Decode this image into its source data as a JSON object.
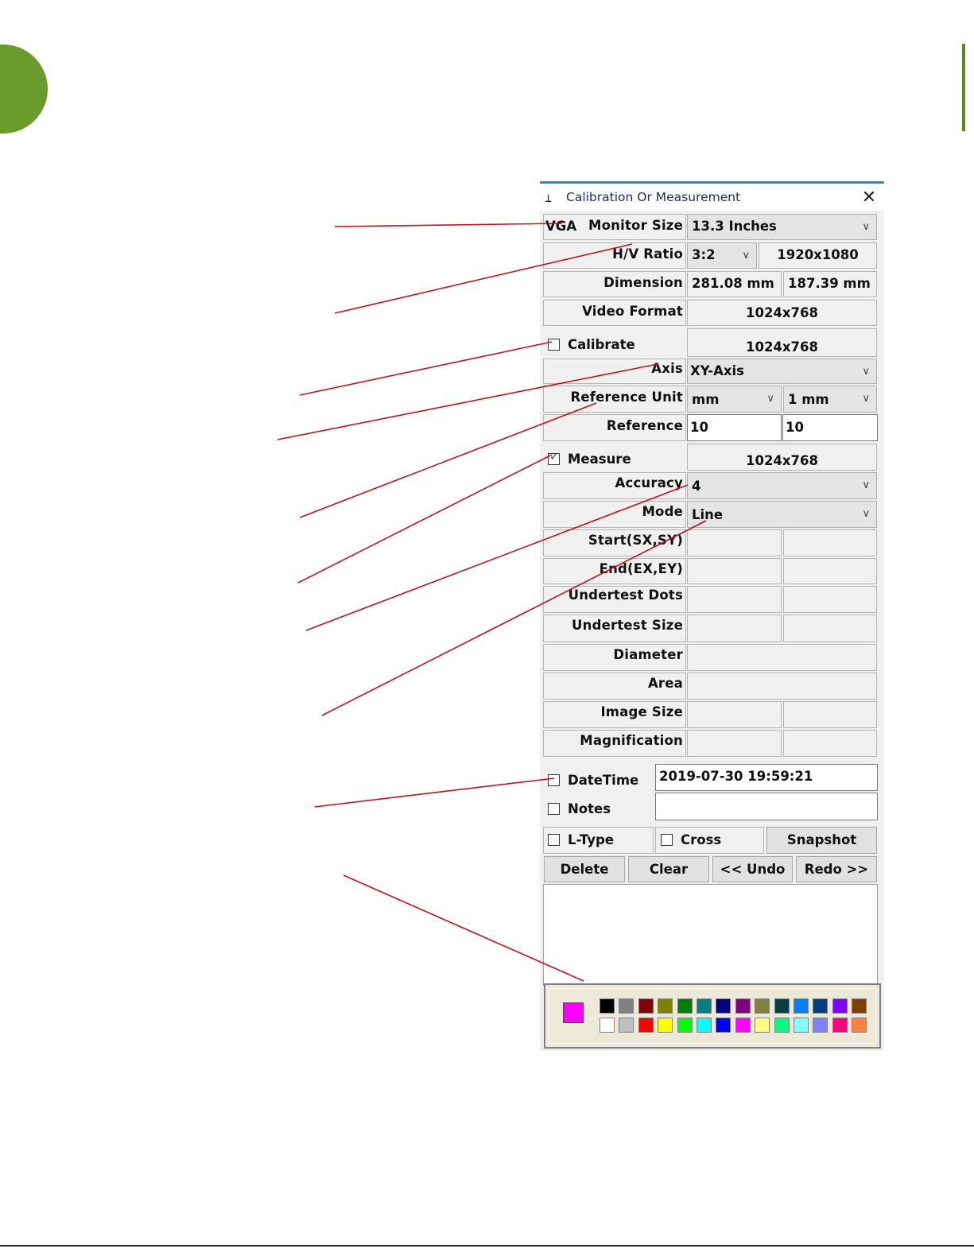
{
  "window": {
    "title": "Calibration Or Measurement",
    "icon": "measure-ruler-icon",
    "close_glyph": "✕"
  },
  "calibration_header": {
    "vga_label": "VGA",
    "monitor_size_label": "Monitor Size",
    "monitor_size_value": "13.3 Inches",
    "hv_ratio_label": "H/V Ratio",
    "hv_ratio_value": "3:2",
    "resolution": "1920x1080",
    "dimension_label": "Dimension",
    "dimension_w": "281.08 mm",
    "dimension_h": "187.39 mm",
    "video_format_label": "Video Format",
    "video_format_value": "1024x768"
  },
  "calibrate": {
    "label": "Calibrate",
    "checked": false,
    "format": "1024x768",
    "axis_label": "Axis",
    "axis_value": "XY-Axis",
    "ref_unit_label": "Reference Unit",
    "ref_unit_value": "mm",
    "ref_unit_step": "1 mm",
    "reference_label": "Reference",
    "reference_x": "10",
    "reference_y": "10"
  },
  "measure": {
    "label": "Measure",
    "checked": true,
    "format": "1024x768",
    "accuracy_label": "Accuracy",
    "accuracy_value": "4",
    "mode_label": "Mode",
    "mode_value": "Line",
    "rows": {
      "start": "Start(SX,SY)",
      "end": "End(EX,EY)",
      "undertest_dots": "Undertest Dots",
      "undertest_size": "Undertest Size",
      "diameter": "Diameter",
      "area": "Area",
      "image_size": "Image Size",
      "magnification": "Magnification"
    }
  },
  "datetime": {
    "label": "DateTime",
    "checked": false,
    "value": "2019-07-30  19:59:21"
  },
  "notes": {
    "label": "Notes",
    "checked": false,
    "value": ""
  },
  "options": {
    "ltype_label": "L-Type",
    "cross_label": "Cross",
    "snapshot_label": "Snapshot"
  },
  "actions": {
    "delete": "Delete",
    "clear": "Clear",
    "undo": "<< Undo",
    "redo": "Redo >>"
  },
  "palette": {
    "current_color": "#ff00ff",
    "row1": [
      "#000000",
      "#808080",
      "#800000",
      "#808000",
      "#008000",
      "#008080",
      "#000080",
      "#800080",
      "#808040",
      "#004040",
      "#0080ff",
      "#004080",
      "#8000ff",
      "#804000"
    ],
    "row2": [
      "#ffffff",
      "#c0c0c0",
      "#ff0000",
      "#ffff00",
      "#00ff00",
      "#00ffff",
      "#0000ff",
      "#ff00ff",
      "#ffff80",
      "#00ff80",
      "#80ffff",
      "#8080ff",
      "#ff0080",
      "#ff8040"
    ]
  },
  "theme": {
    "accent_green": "#6a9b2c",
    "leader_line": "#c0121b",
    "title_accent": "#4d7ea8"
  }
}
